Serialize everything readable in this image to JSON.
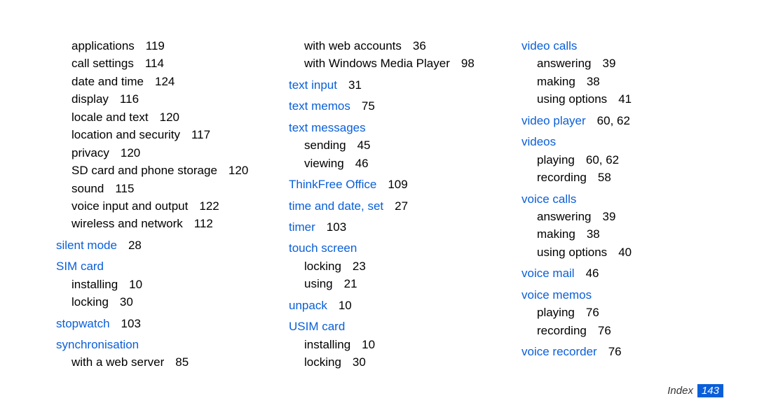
{
  "footer": {
    "label": "Index",
    "page": "143"
  },
  "entries": [
    {
      "type": "sub",
      "text": "applications",
      "pages": "119"
    },
    {
      "type": "sub",
      "text": "call settings",
      "pages": "114"
    },
    {
      "type": "sub",
      "text": "date and time",
      "pages": "124"
    },
    {
      "type": "sub",
      "text": "display",
      "pages": "116"
    },
    {
      "type": "sub",
      "text": "locale and text",
      "pages": "120"
    },
    {
      "type": "sub",
      "text": "location and security",
      "pages": "117"
    },
    {
      "type": "sub",
      "text": "privacy",
      "pages": "120"
    },
    {
      "type": "sub",
      "text": "SD card and phone storage",
      "pages": "120"
    },
    {
      "type": "sub",
      "text": "sound",
      "pages": "115"
    },
    {
      "type": "sub",
      "text": "voice input and output",
      "pages": "122"
    },
    {
      "type": "sub",
      "text": "wireless and network",
      "pages": "112"
    },
    {
      "type": "term",
      "text": "silent mode",
      "pages": "28"
    },
    {
      "type": "term",
      "text": "SIM card",
      "pages": ""
    },
    {
      "type": "sub",
      "text": "installing",
      "pages": "10"
    },
    {
      "type": "sub",
      "text": "locking",
      "pages": "30"
    },
    {
      "type": "term",
      "text": "stopwatch",
      "pages": "103"
    },
    {
      "type": "term",
      "text": "synchronisation",
      "pages": ""
    },
    {
      "type": "sub",
      "text": "with a web server",
      "pages": "85"
    },
    {
      "type": "sub",
      "text": "with web accounts",
      "pages": "36"
    },
    {
      "type": "sub",
      "text": "with Windows Media Player",
      "pages": "98"
    },
    {
      "type": "term",
      "text": "text input",
      "pages": "31"
    },
    {
      "type": "term",
      "text": "text memos",
      "pages": "75"
    },
    {
      "type": "term",
      "text": "text messages",
      "pages": ""
    },
    {
      "type": "sub",
      "text": "sending",
      "pages": "45"
    },
    {
      "type": "sub",
      "text": "viewing",
      "pages": "46"
    },
    {
      "type": "term",
      "text": "ThinkFree Office",
      "pages": "109"
    },
    {
      "type": "term",
      "text": "time and date, set",
      "pages": "27"
    },
    {
      "type": "term",
      "text": "timer",
      "pages": "103"
    },
    {
      "type": "term",
      "text": "touch screen",
      "pages": ""
    },
    {
      "type": "sub",
      "text": "locking",
      "pages": "23"
    },
    {
      "type": "sub",
      "text": "using",
      "pages": "21"
    },
    {
      "type": "term",
      "text": "unpack",
      "pages": "10"
    },
    {
      "type": "term",
      "text": "USIM card",
      "pages": ""
    },
    {
      "type": "sub",
      "text": "installing",
      "pages": "10"
    },
    {
      "type": "sub",
      "text": "locking",
      "pages": "30"
    },
    {
      "type": "term",
      "text": "video calls",
      "pages": ""
    },
    {
      "type": "sub",
      "text": "answering",
      "pages": "39"
    },
    {
      "type": "sub",
      "text": "making",
      "pages": "38"
    },
    {
      "type": "sub",
      "text": "using options",
      "pages": "41"
    },
    {
      "type": "term",
      "text": "video player",
      "pages": "60, 62"
    },
    {
      "type": "term",
      "text": "videos",
      "pages": ""
    },
    {
      "type": "sub",
      "text": "playing",
      "pages": "60, 62"
    },
    {
      "type": "sub",
      "text": "recording",
      "pages": "58"
    },
    {
      "type": "term",
      "text": "voice calls",
      "pages": ""
    },
    {
      "type": "sub",
      "text": "answering",
      "pages": "39"
    },
    {
      "type": "sub",
      "text": "making",
      "pages": "38"
    },
    {
      "type": "sub",
      "text": "using options",
      "pages": "40"
    },
    {
      "type": "term",
      "text": "voice mail",
      "pages": "46"
    },
    {
      "type": "term",
      "text": "voice memos",
      "pages": ""
    },
    {
      "type": "sub",
      "text": "playing",
      "pages": "76"
    },
    {
      "type": "sub",
      "text": "recording",
      "pages": "76"
    },
    {
      "type": "term",
      "text": "voice recorder",
      "pages": "76"
    }
  ]
}
